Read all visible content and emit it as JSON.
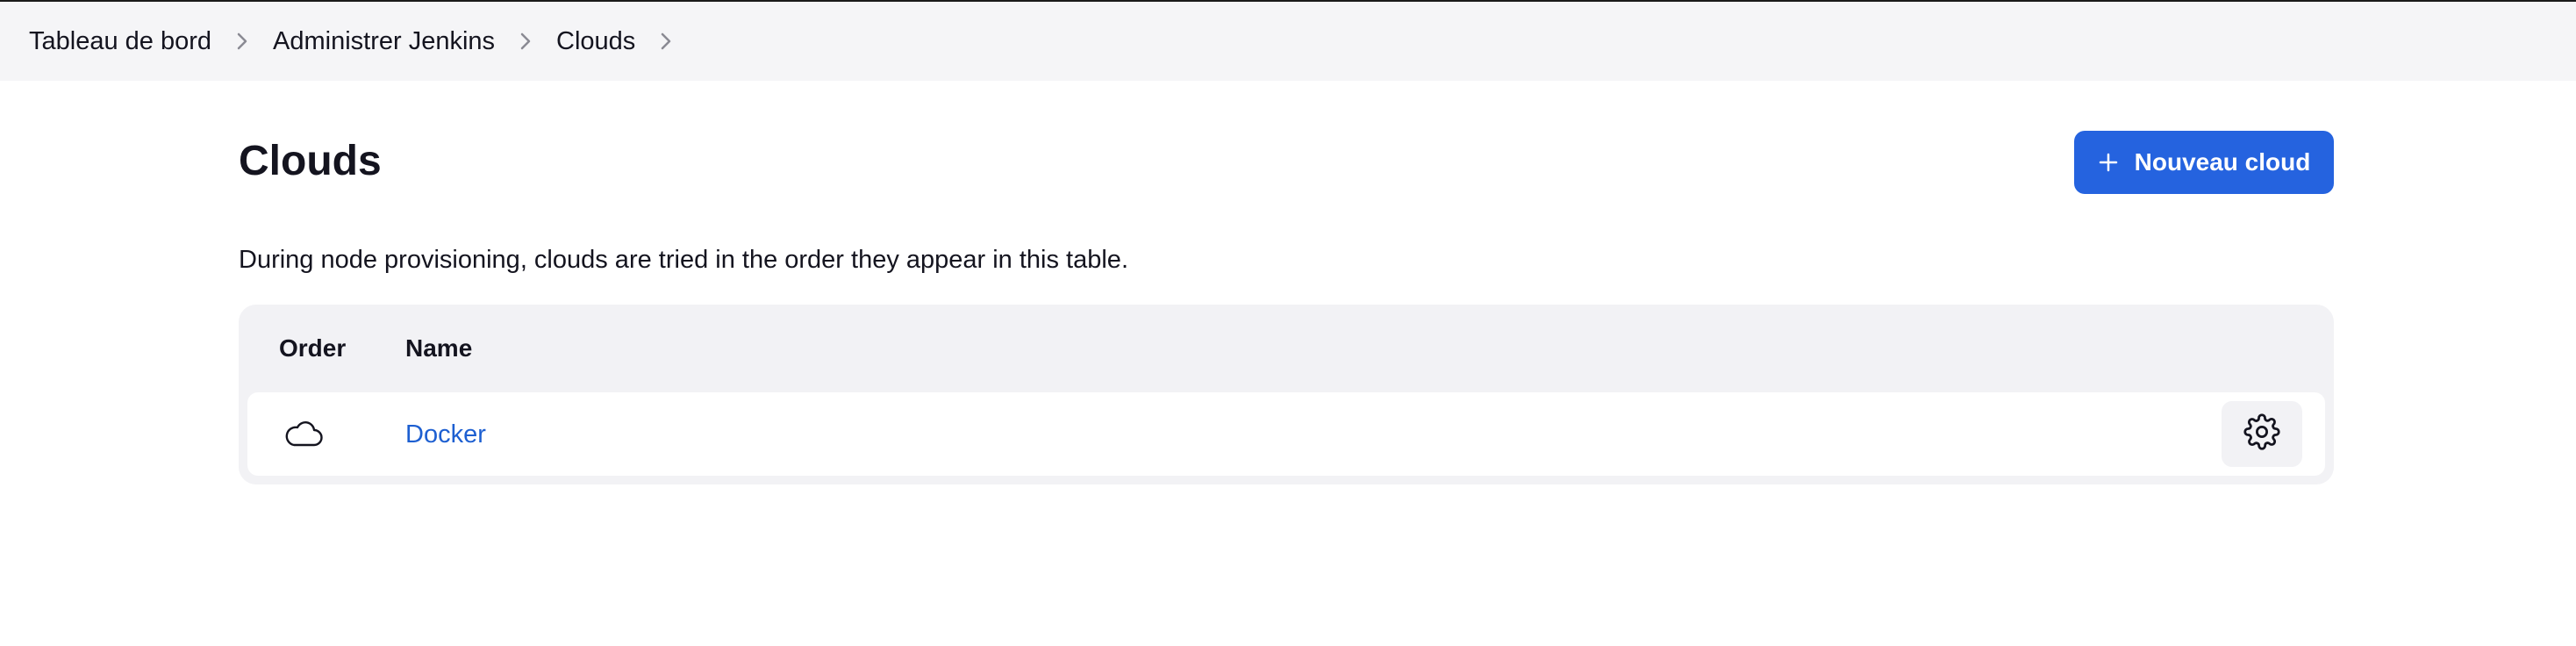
{
  "breadcrumb": {
    "items": [
      {
        "label": "Tableau de bord"
      },
      {
        "label": "Administrer Jenkins"
      },
      {
        "label": "Clouds"
      }
    ]
  },
  "page": {
    "title": "Clouds",
    "new_cloud_label": "Nouveau cloud",
    "description": "During node provisioning, clouds are tried in the order they appear in this table."
  },
  "table": {
    "headers": {
      "order": "Order",
      "name": "Name"
    },
    "rows": [
      {
        "icon": "cloud-icon",
        "name": "Docker",
        "action_icon": "gear-icon"
      }
    ]
  },
  "colors": {
    "accent": "#2563df",
    "link": "#1d5fd1",
    "breadcrumb_bg": "#f5f5f7",
    "table_bg": "#f2f2f5"
  }
}
